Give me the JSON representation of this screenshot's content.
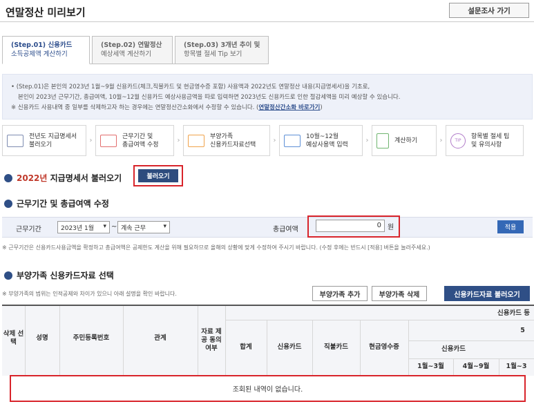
{
  "header": {
    "title": "연말정산 미리보기",
    "survey_button": "설문조사 가기"
  },
  "tabs": [
    {
      "step": "(Step.01) 신용카드",
      "sub": "소득공제액 계산하기"
    },
    {
      "step": "(Step.02) 연말정산",
      "sub": "예상세액 계산하기"
    },
    {
      "step": "(Step.03) 3개년 추이 및",
      "sub": "항목별 절세 Tip 보기"
    }
  ],
  "info": {
    "line1": "• (Step.01)은 본인의 2023년 1월~9월 신용카드(체크,직불카드 및 현금영수증 포함) 사용액과 2022년도 연말정산 내용(지급명세서)을 기초로,",
    "line2": "본인이 2023년 근무기간, 총급여액, 10월~12월 신용카드 예상사용금액을 따로 입력하면 2023년도 신용카드로 인한 절감세액을 미리 예상할 수 있습니다.",
    "line3": "※ 신용카드 사용내역 중 일부를 삭제하고자 하는 경우에는 연말정산간소화에서 수정할 수 있습니다. (",
    "link": "연말정산간소화 바로가기",
    "line3_end": ")"
  },
  "steps": [
    {
      "label1": "전년도 지급명세서",
      "label2": "불러오기",
      "icon": "document-icon",
      "color": "#7d8bb0"
    },
    {
      "label1": "근무기간 및",
      "label2": "총급여액 수정",
      "icon": "calendar-icon",
      "color": "#e26d6d"
    },
    {
      "label1": "부양가족",
      "label2": "신용카드자료선택",
      "icon": "monitor-icon",
      "color": "#f0a24a"
    },
    {
      "label1": "10월~12월",
      "label2": "예상사용액 입력",
      "icon": "card-icon",
      "color": "#5d8fd6"
    },
    {
      "label1": "계산하기",
      "label2": "",
      "icon": "calculator-icon",
      "color": "#6fb56f"
    },
    {
      "label1": "항목별 절세 팁",
      "label2": "및 유의사항",
      "icon": "tip-icon",
      "color": "#b07ac9",
      "icon_text": "TIP"
    }
  ],
  "section1": {
    "year": "2022년",
    "title": "지급명세서 불러오기",
    "button": "불러오기"
  },
  "section2": {
    "title": "근무기간 및 총급여액 수정",
    "period_label": "근무기간",
    "start_value": "2023년 1월",
    "tilde": "~",
    "end_value": "계속 근무",
    "amount_label": "총급여액",
    "amount_value": "0",
    "unit": "원",
    "apply": "적용",
    "note": "※ 근무기간은 신용카드사용금액을 확정하고 총급여액은 공제한도 계산을 위해 필요하므로 올해의 상황에 맞게 수정하여 주시기 바랍니다. (수정 후에는 반드시 [적용] 버튼을 눌러주세요.)"
  },
  "section3": {
    "title": "부양가족 신용카드자료 선택",
    "note": "※ 부양가족의 범위는 인적공제와 차이가 있으니 아래 설명을 확인 바랍니다.",
    "add": "부양가족 추가",
    "remove": "부양가족 삭제",
    "load": "신용카드자료 불러오기"
  },
  "table": {
    "h_select": "삭제 선택",
    "h_name": "성명",
    "h_rrn": "주민등록번호",
    "h_relation": "관계",
    "h_consent": "자료 제공 동의 여부",
    "h_group": "신용카드 등",
    "h_five": "5",
    "h_total": "합계",
    "h_credit": "신용카드",
    "h_debit": "직불카드",
    "h_cash": "현금영수증",
    "h_credit2": "신용카드",
    "h_m1": "1월~3월",
    "h_m2": "4월~9월",
    "h_m3": "1월~3",
    "empty": "조회된 내역이 없습니다."
  }
}
